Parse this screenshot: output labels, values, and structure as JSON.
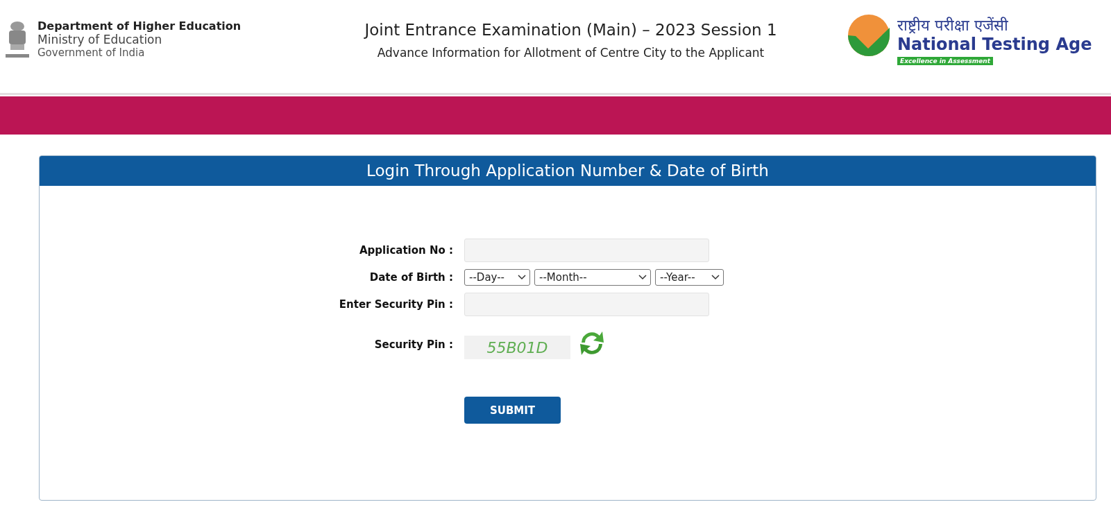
{
  "header": {
    "ministry": {
      "department": "Department of Higher Education",
      "ministry": "Ministry of Education",
      "government": "Government of India"
    },
    "title": "Joint Entrance Examination (Main) – 2023 Session 1",
    "subtitle": "Advance Information for Allotment of Centre City to the Applicant",
    "agency": {
      "hindi": "राष्ट्रीय परीक्षा एजेंसी",
      "name": "National Testing Age",
      "tagline": "Excellence in Assessment"
    }
  },
  "login": {
    "title": "Login Through Application Number & Date of Birth",
    "fields": [
      {
        "kind": "input",
        "label": "Application No :"
      },
      {
        "kind": "date",
        "label": "Date of Birth :",
        "selects": [
          "--Day--",
          "--Month--",
          "--Year--"
        ]
      },
      {
        "kind": "input",
        "label": "Enter Security Pin :"
      },
      {
        "kind": "captcha",
        "label": "Security Pin :",
        "code": "55B01D"
      }
    ],
    "submit": "SUBMIT"
  }
}
